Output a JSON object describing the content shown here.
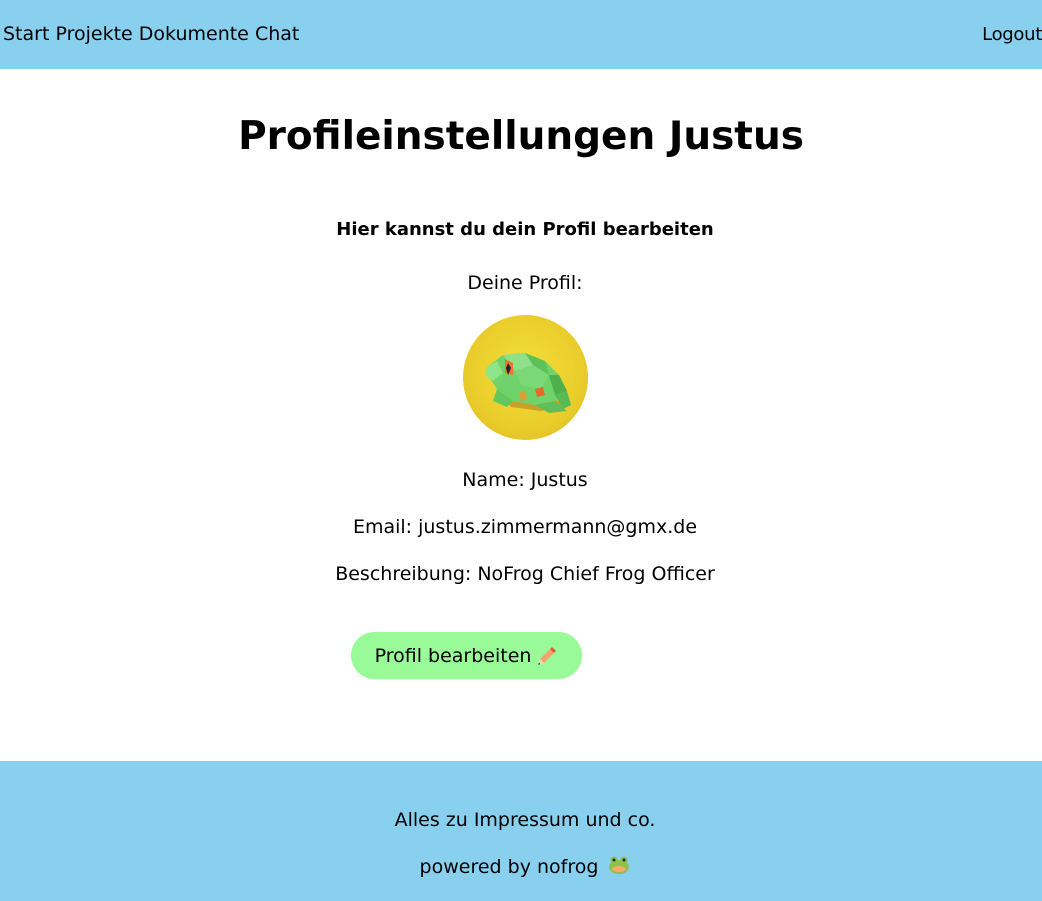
{
  "nav": {
    "links": [
      "Start",
      "Projekte",
      "Dokumente",
      "Chat"
    ],
    "logout": "Logout"
  },
  "main": {
    "title": "Profileinstellungen Justus",
    "subtitle": "Hier kannst du dein Profil bearbeiten",
    "profile_label": "Deine Profil:",
    "avatar_icon": "frog-avatar",
    "name_line": "Name: Justus",
    "email_line": "Email: justus.zimmermann@gmx.de",
    "description_line": "Beschreibung: NoFrog Chief Frog Officer",
    "edit_button_label": "Profil bearbeiten",
    "edit_button_icon": "pencil-icon"
  },
  "footer": {
    "imprint_text": "Alles zu Impressum und co.",
    "powered_text": "powered by nofrog",
    "powered_icon": "frog-icon"
  },
  "colors": {
    "header_bg": "#89d0ee",
    "footer_bg": "#89d0ee",
    "button_bg": "#98fb98"
  }
}
